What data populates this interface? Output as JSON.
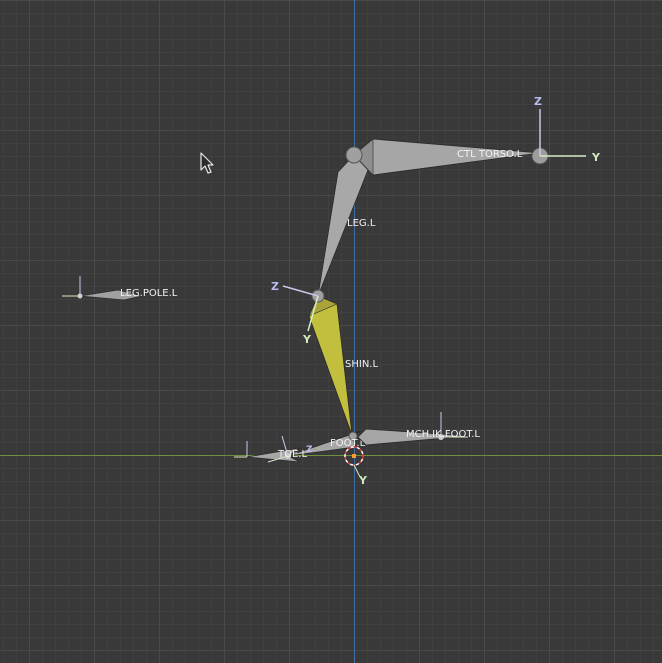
{
  "viewport": {
    "background": "#393939",
    "grid_major": "#4a4a4a",
    "grid_minor": "#404040",
    "x_axis_color": "#6f8f3a",
    "z_axis_color": "#3f6fa8",
    "bone_color": "#a9a9a9",
    "bone_selected_color": "#c5c03c"
  },
  "bones": {
    "ctl_torso": "CTL TORSO.L",
    "leg": "LEG.L",
    "leg_pole": "LEG.POLE.L",
    "shin": "SHIN.L",
    "foot": "FOOT.L",
    "mch_ik_foot": "MCH.IK.FOOT.L",
    "toe": "TOE.L"
  },
  "axes": {
    "torso_z": "Z",
    "torso_y": "Y",
    "knee_z": "Z",
    "knee_y": "Y",
    "cursor_y": "Y",
    "toe_z": "Z"
  },
  "icons": {
    "cursor": "mouse-pointer-icon",
    "cursor3d": "3d-cursor-icon"
  }
}
